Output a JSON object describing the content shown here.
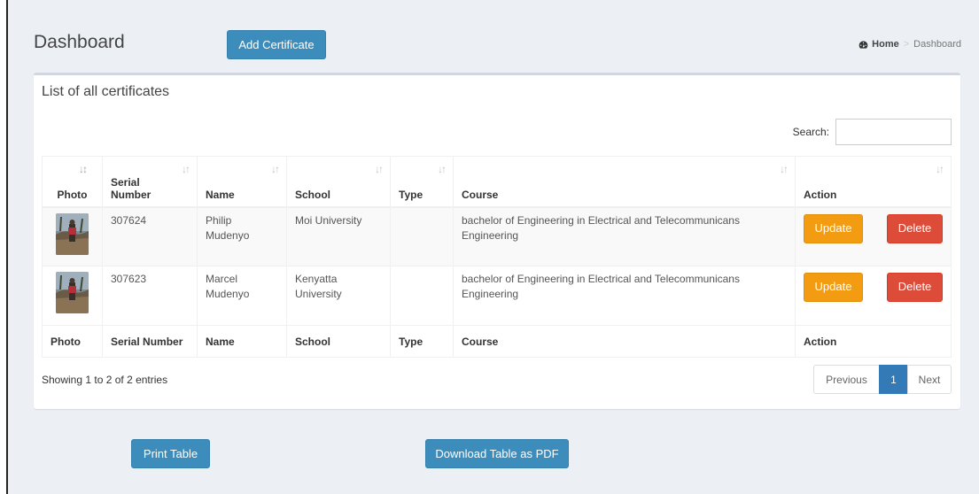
{
  "header": {
    "title": "Dashboard",
    "add_button": "Add Certificate"
  },
  "breadcrumb": {
    "home": "Home",
    "current": "Dashboard",
    "separator": ">"
  },
  "box": {
    "title": "List of all certificates",
    "search_label": "Search:",
    "search_value": ""
  },
  "table": {
    "headers": {
      "photo": "Photo",
      "serial_line1": "Serial",
      "serial_line2": "Number",
      "name": "Name",
      "school": "School",
      "type": "Type",
      "course": "Course",
      "action": "Action"
    },
    "footers": {
      "photo": "Photo",
      "serial": "Serial Number",
      "name": "Name",
      "school": "School",
      "type": "Type",
      "course": "Course",
      "action": "Action"
    },
    "rows": [
      {
        "serial": "307624",
        "name_line1": "Philip",
        "name_line2": "Mudenyo",
        "school_line1": "Moi University",
        "school_line2": "",
        "type": "",
        "course_line1": "bachelor of Engineering in Electrical and Telecommunicans",
        "course_line2": "Engineering",
        "update": "Update",
        "delete": "Delete"
      },
      {
        "serial": "307623",
        "name_line1": "Marcel",
        "name_line2": "Mudenyo",
        "school_line1": "Kenyatta",
        "school_line2": "University",
        "type": "",
        "course_line1": "bachelor of Engineering in Electrical and Telecommunicans",
        "course_line2": "Engineering",
        "update": "Update",
        "delete": "Delete"
      }
    ],
    "info": "Showing 1 to 2 of 2 entries"
  },
  "pagination": {
    "previous": "Previous",
    "current_page": "1",
    "next": "Next"
  },
  "bottom": {
    "print": "Print Table",
    "pdf": "Download Table as PDF"
  },
  "colors": {
    "primary": "#3c8dbc",
    "warning": "#f39c12",
    "danger": "#dd4b39",
    "page_active": "#337ab7",
    "background": "#ecf0f5"
  }
}
